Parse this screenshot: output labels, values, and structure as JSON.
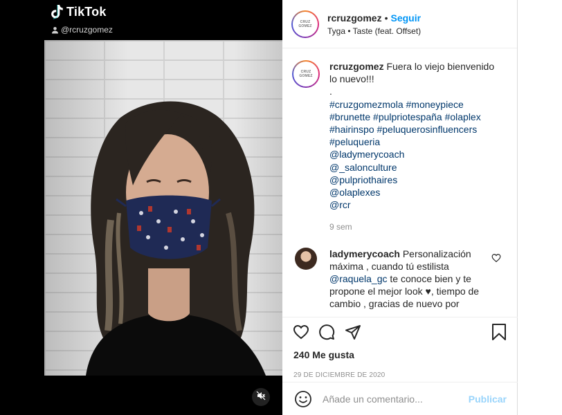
{
  "video": {
    "brand": "TikTok",
    "handle": "@rcruzgomez",
    "icons": {
      "logo": "tiktok-note-icon",
      "user": "user-icon",
      "mute": "speaker-muted-icon"
    }
  },
  "header": {
    "username": "rcruzgomez",
    "separator": "•",
    "follow_label": "Seguir",
    "song": "Tyga • Taste (feat. Offset)",
    "avatar_text": "CRUZ GOMEZ"
  },
  "caption": {
    "username": "rcruzgomez",
    "text": "Fuera lo viejo bienvenido lo nuevo!!!",
    "dot": ".",
    "lines": [
      "#cruzgomezmola #moneypiece",
      "#brunette #pulpriotespaña #olaplex",
      "#hairinspo #peluquerosinfluencers",
      "#peluqueria",
      "@ladymerycoach",
      "@_salonculture",
      "@pulpriothaires",
      "@olaplexes",
      "@rcr"
    ],
    "time": "9 sem"
  },
  "comment": {
    "username": "ladymerycoach",
    "text_before": "Personalización máxima , cuando tú estilista",
    "mention": "@raquela_gc",
    "text_after": "te conoce bien y te propone el mejor look ♥, tiempo de cambio , gracias de nuevo por"
  },
  "actions": {
    "likes": "240 Me gusta",
    "date": "29 de diciembre de 2020",
    "icons": [
      "heart-icon",
      "comment-icon",
      "share-icon",
      "bookmark-icon"
    ]
  },
  "add_comment": {
    "placeholder": "Añade un comentario...",
    "publish_label": "Publicar"
  },
  "colors": {
    "accent": "#0095f6",
    "link": "#00376b",
    "muted": "#8e8e8e",
    "text": "#262626"
  }
}
